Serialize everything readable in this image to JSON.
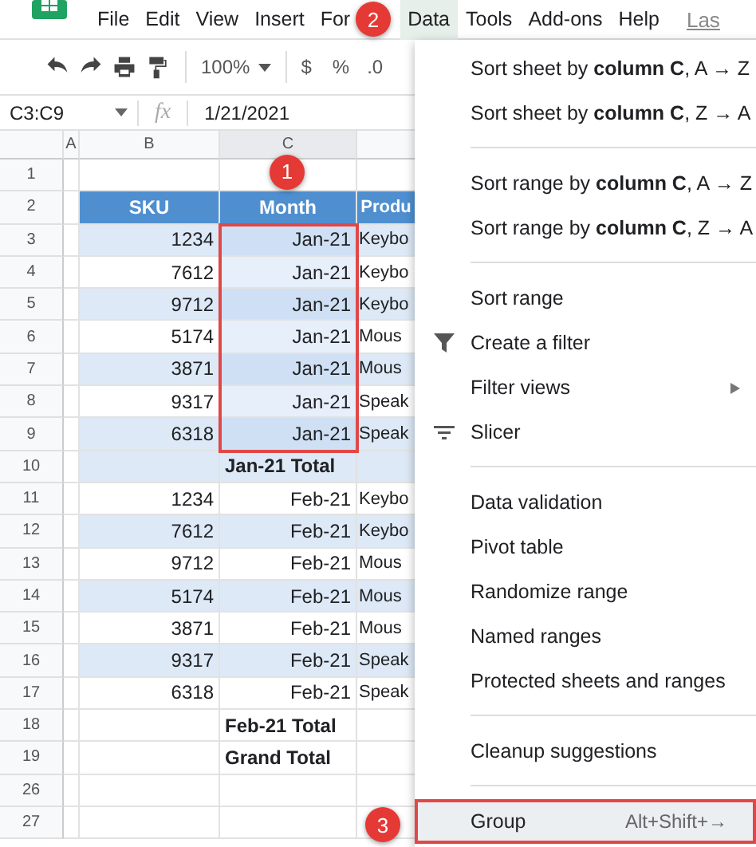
{
  "menubar": {
    "items": [
      {
        "label": "File",
        "selected": false
      },
      {
        "label": "Edit",
        "selected": false
      },
      {
        "label": "View",
        "selected": false
      },
      {
        "label": "Insert",
        "selected": false
      },
      {
        "label": "For",
        "selected": false
      },
      {
        "label": "Data",
        "selected": true
      },
      {
        "label": "Tools",
        "selected": false
      },
      {
        "label": "Add-ons",
        "selected": false
      },
      {
        "label": "Help",
        "selected": false
      }
    ],
    "last_edit": "Las"
  },
  "toolbar": {
    "zoom": "100%",
    "currency": "$",
    "percent": "%",
    "decimal": ".0"
  },
  "formula_bar": {
    "name_box": "C3:C9",
    "fx": "fx",
    "value": "1/21/2021"
  },
  "columns": [
    "A",
    "B",
    "C"
  ],
  "rows": [
    {
      "number": "1",
      "kind": "empty",
      "band": false
    },
    {
      "number": "2",
      "kind": "header",
      "cells": [
        "SKU",
        "Month",
        "Produ"
      ]
    },
    {
      "number": "3",
      "kind": "data",
      "sku": "1234",
      "month": "Jan-21",
      "product": "Keybo",
      "band": true,
      "in_selection": true
    },
    {
      "number": "4",
      "kind": "data",
      "sku": "7612",
      "month": "Jan-21",
      "product": "Keybo",
      "band": false,
      "in_selection": true
    },
    {
      "number": "5",
      "kind": "data",
      "sku": "9712",
      "month": "Jan-21",
      "product": "Keybo",
      "band": true,
      "in_selection": true
    },
    {
      "number": "6",
      "kind": "data",
      "sku": "5174",
      "month": "Jan-21",
      "product": "Mous",
      "band": false,
      "in_selection": true
    },
    {
      "number": "7",
      "kind": "data",
      "sku": "3871",
      "month": "Jan-21",
      "product": "Mous",
      "band": true,
      "in_selection": true
    },
    {
      "number": "8",
      "kind": "data",
      "sku": "9317",
      "month": "Jan-21",
      "product": "Speak",
      "band": false,
      "in_selection": true
    },
    {
      "number": "9",
      "kind": "data",
      "sku": "6318",
      "month": "Jan-21",
      "product": "Speak",
      "band": true,
      "in_selection": true
    },
    {
      "number": "10",
      "kind": "total",
      "label": "Jan-21 Total",
      "band": true
    },
    {
      "number": "11",
      "kind": "data",
      "sku": "1234",
      "month": "Feb-21",
      "product": "Keybo",
      "band": false,
      "in_selection": false
    },
    {
      "number": "12",
      "kind": "data",
      "sku": "7612",
      "month": "Feb-21",
      "product": "Keybo",
      "band": true,
      "in_selection": false
    },
    {
      "number": "13",
      "kind": "data",
      "sku": "9712",
      "month": "Feb-21",
      "product": "Mous",
      "band": false,
      "in_selection": false
    },
    {
      "number": "14",
      "kind": "data",
      "sku": "5174",
      "month": "Feb-21",
      "product": "Mous",
      "band": true,
      "in_selection": false
    },
    {
      "number": "15",
      "kind": "data",
      "sku": "3871",
      "month": "Feb-21",
      "product": "Mous",
      "band": false,
      "in_selection": false
    },
    {
      "number": "16",
      "kind": "data",
      "sku": "9317",
      "month": "Feb-21",
      "product": "Speak",
      "band": true,
      "in_selection": false
    },
    {
      "number": "17",
      "kind": "data",
      "sku": "6318",
      "month": "Feb-21",
      "product": "Speak",
      "band": false,
      "in_selection": false
    },
    {
      "number": "18",
      "kind": "total",
      "label": "Feb-21 Total",
      "band": false
    },
    {
      "number": "19",
      "kind": "total",
      "label": "Grand Total",
      "band": false
    },
    {
      "number": "26",
      "kind": "empty",
      "band": false
    },
    {
      "number": "27",
      "kind": "empty",
      "band": false
    }
  ],
  "data_menu": {
    "sections": [
      [
        {
          "label": "Sort sheet by **column C**, A → Z",
          "kind": "plain",
          "submenu": false,
          "highlighted": false
        },
        {
          "label": "Sort sheet by **column C**, Z → A",
          "kind": "plain",
          "submenu": false,
          "highlighted": false
        }
      ],
      [
        {
          "label": "Sort range by **column C**, A → Z",
          "kind": "plain",
          "submenu": false,
          "highlighted": false
        },
        {
          "label": "Sort range by **column C**, Z → A",
          "kind": "plain",
          "submenu": false,
          "highlighted": false
        }
      ],
      [
        {
          "label": "Sort range",
          "kind": "plain",
          "submenu": false,
          "highlighted": false
        },
        {
          "label": "Create a filter",
          "kind": "filter",
          "submenu": false,
          "highlighted": false
        },
        {
          "label": "Filter views",
          "kind": "plain",
          "submenu": true,
          "highlighted": false
        },
        {
          "label": "Slicer",
          "kind": "slicer",
          "submenu": false,
          "highlighted": false
        }
      ],
      [
        {
          "label": "Data validation",
          "kind": "plain",
          "submenu": false,
          "highlighted": false
        },
        {
          "label": "Pivot table",
          "kind": "plain",
          "submenu": false,
          "highlighted": false
        },
        {
          "label": "Randomize range",
          "kind": "plain",
          "submenu": false,
          "highlighted": false
        },
        {
          "label": "Named ranges",
          "kind": "plain",
          "submenu": false,
          "highlighted": false
        },
        {
          "label": "Protected sheets and ranges",
          "kind": "plain",
          "submenu": false,
          "highlighted": false
        }
      ],
      [
        {
          "label": "Cleanup suggestions",
          "kind": "plain",
          "submenu": false,
          "highlighted": false
        }
      ],
      [
        {
          "label": "Group",
          "kind": "plain",
          "submenu": false,
          "shortcut": "Alt+Shift+→",
          "highlighted": true
        }
      ]
    ]
  },
  "callouts": [
    "1",
    "2",
    "3"
  ]
}
